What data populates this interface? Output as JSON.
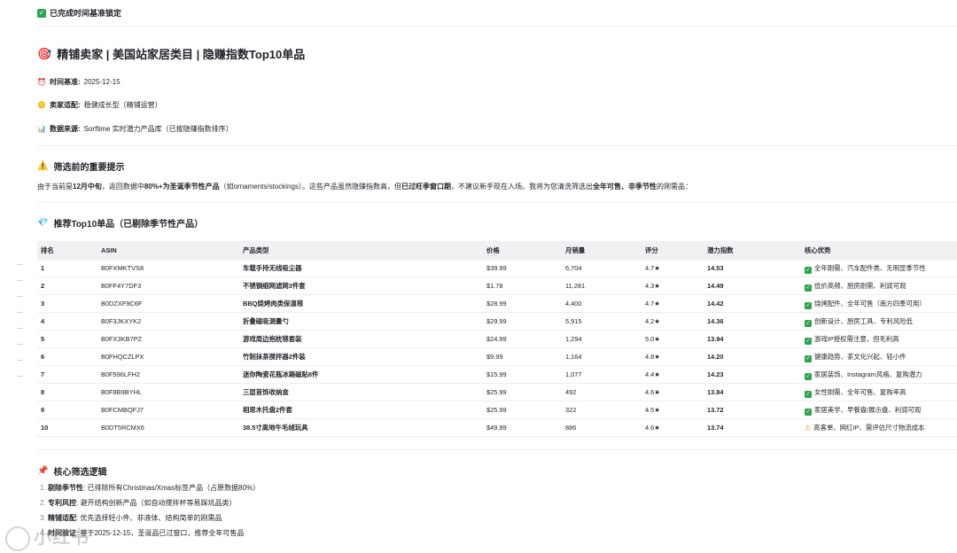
{
  "status": {
    "label": "已完成时间基准锁定"
  },
  "title": {
    "icon": "target-icon",
    "text": "精铺卖家 | 美国站家居类目 | 隐赚指数Top10单品"
  },
  "meta": [
    {
      "icon": "alarm-clock-icon",
      "label": "时间基准:",
      "value": "2025-12-15"
    },
    {
      "icon": "coin-icon",
      "label": "卖家适配:",
      "value": "稳健成长型（精铺运营）"
    },
    {
      "icon": "bar-chart-icon",
      "label": "数据来源:",
      "value": "Sorftime 实时潜力产品库（已按隐赚指数排序）"
    }
  ],
  "notice": {
    "heading": "筛选前的重要提示",
    "p1": "由于当前是",
    "b1": "12月中旬",
    "p2": "，返回数据中",
    "b2": "80%+为圣诞季节性产品",
    "p3": "（如ornaments/stockings）。这些产品虽然隐赚指数高，但",
    "b3": "已过旺季窗口期",
    "p4": "，不建议新手现在入场。我将为您清洗筛选出",
    "b4": "全年可售、非季节性",
    "p5": "的刚需品："
  },
  "top10": {
    "heading": "推荐Top10单品（已剔除季节性产品）",
    "columns": [
      "排名",
      "ASIN",
      "产品类型",
      "价格",
      "月销量",
      "评分",
      "潜力指数",
      "核心优势"
    ],
    "rows": [
      [
        "1",
        "B0FXMKTVS8",
        "车载手持无线吸尘器",
        "$39.99",
        "6,704",
        "4.7★",
        "14.53",
        "全年刚需、汽车配件类、无明显季节性",
        "ok"
      ],
      [
        "2",
        "B0FF4Y7DF3",
        "不锈钢细网滤网3件套",
        "$1.78",
        "11,281",
        "4.3★",
        "14.49",
        "低价高频、厨房刚需、利润可观",
        "ok"
      ],
      [
        "3",
        "B0DZXF9C6F",
        "BBQ烧烤肉类保温毯",
        "$28.99",
        "4,400",
        "4.7★",
        "14.42",
        "烧烤配件、全年可售（南方四季可用）",
        "ok"
      ],
      [
        "4",
        "B0F3JKXYK2",
        "折叠磁吸测量勺",
        "$29.99",
        "5,915",
        "4.2★",
        "14.36",
        "创新设计、厨房工具、专利风险低",
        "ok"
      ],
      [
        "5",
        "B0FX3KB7PZ",
        "游戏周边抱枕毯套装",
        "$24.99",
        "1,294",
        "5.0★",
        "13.94",
        "游戏IP授权需注意，但毛利高",
        "ok"
      ],
      [
        "6",
        "B0FHQCZLPX",
        "竹制抹茶搅拌器2件装",
        "$9.99",
        "1,164",
        "4.8★",
        "14.20",
        "健康趋势、茶文化兴起、轻小件",
        "ok"
      ],
      [
        "7",
        "B0F596LFH2",
        "迷你陶瓷花瓶冰箱磁贴8件",
        "$15.99",
        "1,077",
        "4.4★",
        "14.23",
        "家居装饰、Instagram风格、复购潜力",
        "ok"
      ],
      [
        "8",
        "B0F8B9BYHL",
        "三层首饰收纳盒",
        "$25.99",
        "492",
        "4.6★",
        "13.84",
        "女性刚需、全年可售、复购率高",
        "ok"
      ],
      [
        "9",
        "B0FCMBQFJ7",
        "相思木托盘2件套",
        "$25.99",
        "322",
        "4.5★",
        "13.72",
        "家居美学、早餐盘/展示盘、利润可观",
        "ok"
      ],
      [
        "10",
        "B0DT5RCMX6",
        "38.5寸高地牛毛绒玩具",
        "$49.99",
        "886",
        "4.6★",
        "13.74",
        "高客单、网红IP、需评估尺寸物流成本",
        "warn"
      ]
    ]
  },
  "logic": {
    "heading": "核心筛选逻辑",
    "items": [
      {
        "b": "剔除季节性",
        "t": ": 已排除所有Christmas/Xmas标签产品（占原数据80%）"
      },
      {
        "b": "专利风控",
        "t": ": 避开结构创新产品（如自动搅拌杯等易踩坑品类）"
      },
      {
        "b": "精铺适配",
        "t": ": 优先选择轻小件、非液体、结构简单的刚需品"
      },
      {
        "b": "时间验证",
        "t": ": 基于2025-12-15，圣诞品已过窗口，推荐全年可售品"
      }
    ]
  },
  "watermark": {
    "text": "小红书"
  }
}
